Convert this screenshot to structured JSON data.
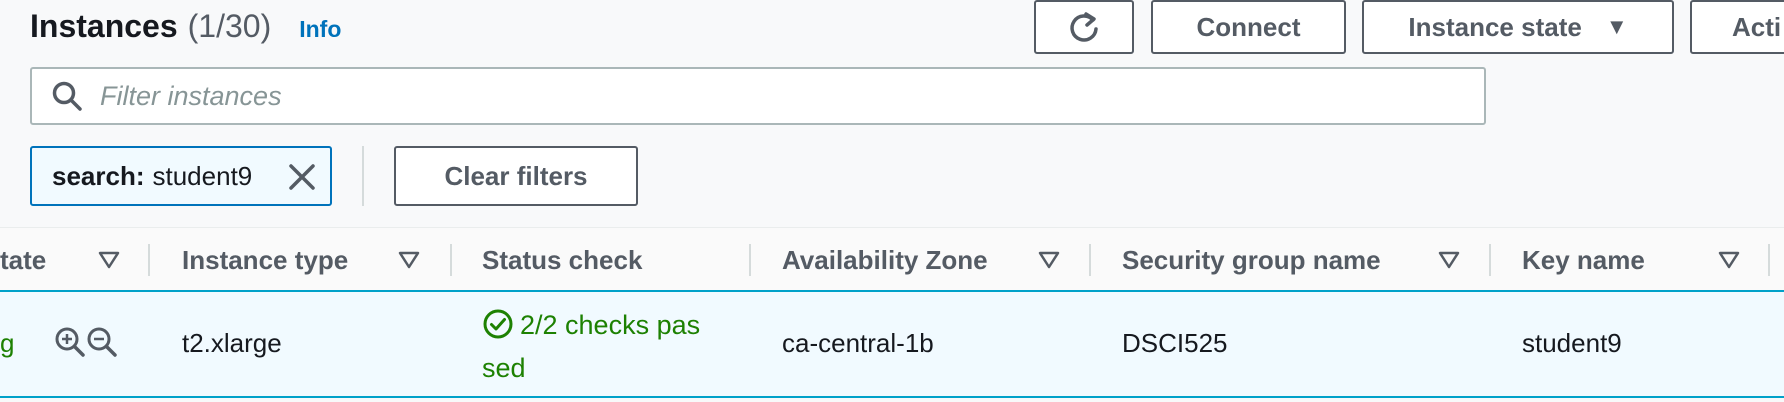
{
  "header": {
    "title": "Instances",
    "count": "(1/30)",
    "info_link": "Info"
  },
  "toolbar": {
    "refresh_icon": "refresh-icon",
    "connect_label": "Connect",
    "instance_state_label": "Instance state",
    "actions_label": "Acti"
  },
  "search": {
    "placeholder": "Filter instances",
    "value": ""
  },
  "filter_token": {
    "key": "search:",
    "value": "student9"
  },
  "clear_filters_label": "Clear filters",
  "table": {
    "columns": [
      {
        "label": "tate"
      },
      {
        "label": "Instance type"
      },
      {
        "label": "Status check"
      },
      {
        "label": "Availability Zone"
      },
      {
        "label": "Security group name"
      },
      {
        "label": "Key name"
      }
    ],
    "row": {
      "state_fragment": "g",
      "instance_type": "t2.xlarge",
      "status_check_line1": "2/2 checks pas",
      "status_check_line2": "sed",
      "availability_zone": "ca-central-1b",
      "security_group": "DSCI525",
      "key_name": "student9"
    }
  },
  "colors": {
    "link": "#0073bb",
    "success": "#1d8102",
    "selected_row_bg": "#f1faff",
    "selected_border": "#00a1c9"
  }
}
